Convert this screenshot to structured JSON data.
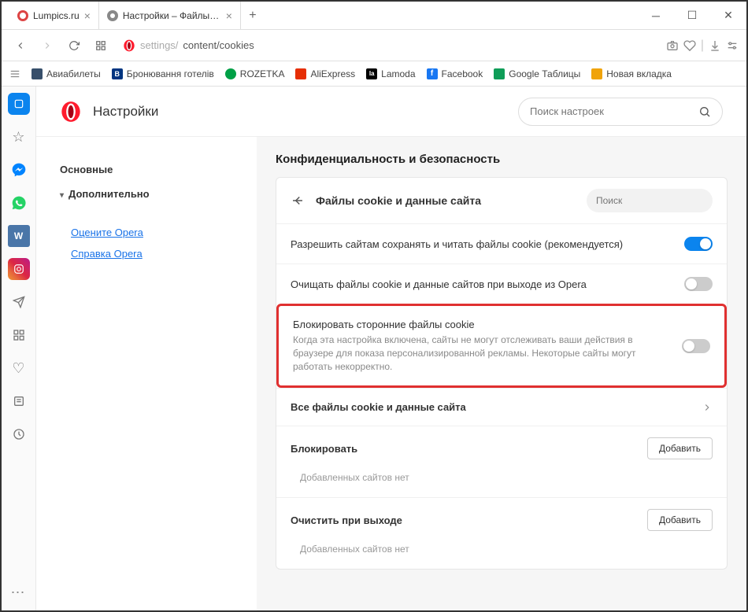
{
  "tabs": [
    {
      "title": "Lumpics.ru",
      "active": false
    },
    {
      "title": "Настройки – Файлы cookie",
      "active": true
    }
  ],
  "address": {
    "prefix": "settings/",
    "path": "content/cookies"
  },
  "bookmarks": [
    {
      "label": "Авиабилеты",
      "color": "#374f6b"
    },
    {
      "label": "Бронювання готелів",
      "color": "#003580"
    },
    {
      "label": "ROZETKA",
      "color": "#00a046"
    },
    {
      "label": "AliExpress",
      "color": "#e62e04"
    },
    {
      "label": "Lamoda",
      "color": "#000"
    },
    {
      "label": "Facebook",
      "color": "#1877f2"
    },
    {
      "label": "Google Таблицы",
      "color": "#0f9d58"
    },
    {
      "label": "Новая вкладка",
      "color": "#f0a30a"
    }
  ],
  "settings": {
    "title": "Настройки",
    "search_placeholder": "Поиск настроек",
    "nav_basic": "Основные",
    "nav_advanced": "Дополнительно",
    "nav_rate": "Оцените Opera",
    "nav_help": "Справка Opera"
  },
  "panel": {
    "section": "Конфиденциальность и безопасность",
    "header": "Файлы cookie и данные сайта",
    "mini_search_placeholder": "Поиск",
    "row_allow": "Разрешить сайтам сохранять и читать файлы cookie (рекомендуется)",
    "row_clear_exit": "Очищать файлы cookie и данные сайтов при выходе из Opera",
    "row_block3p": "Блокировать сторонние файлы cookie",
    "row_block3p_desc": "Когда эта настройка включена, сайты не могут отслеживать ваши действия в браузере для показа персонализированной рекламы. Некоторые сайты могут работать некорректно.",
    "row_allcookies": "Все файлы cookie и данные сайта",
    "block_title": "Блокировать",
    "block_empty": "Добавленных сайтов нет",
    "clear_title": "Очистить при выходе",
    "clear_empty": "Добавленных сайтов нет",
    "add_btn": "Добавить"
  }
}
